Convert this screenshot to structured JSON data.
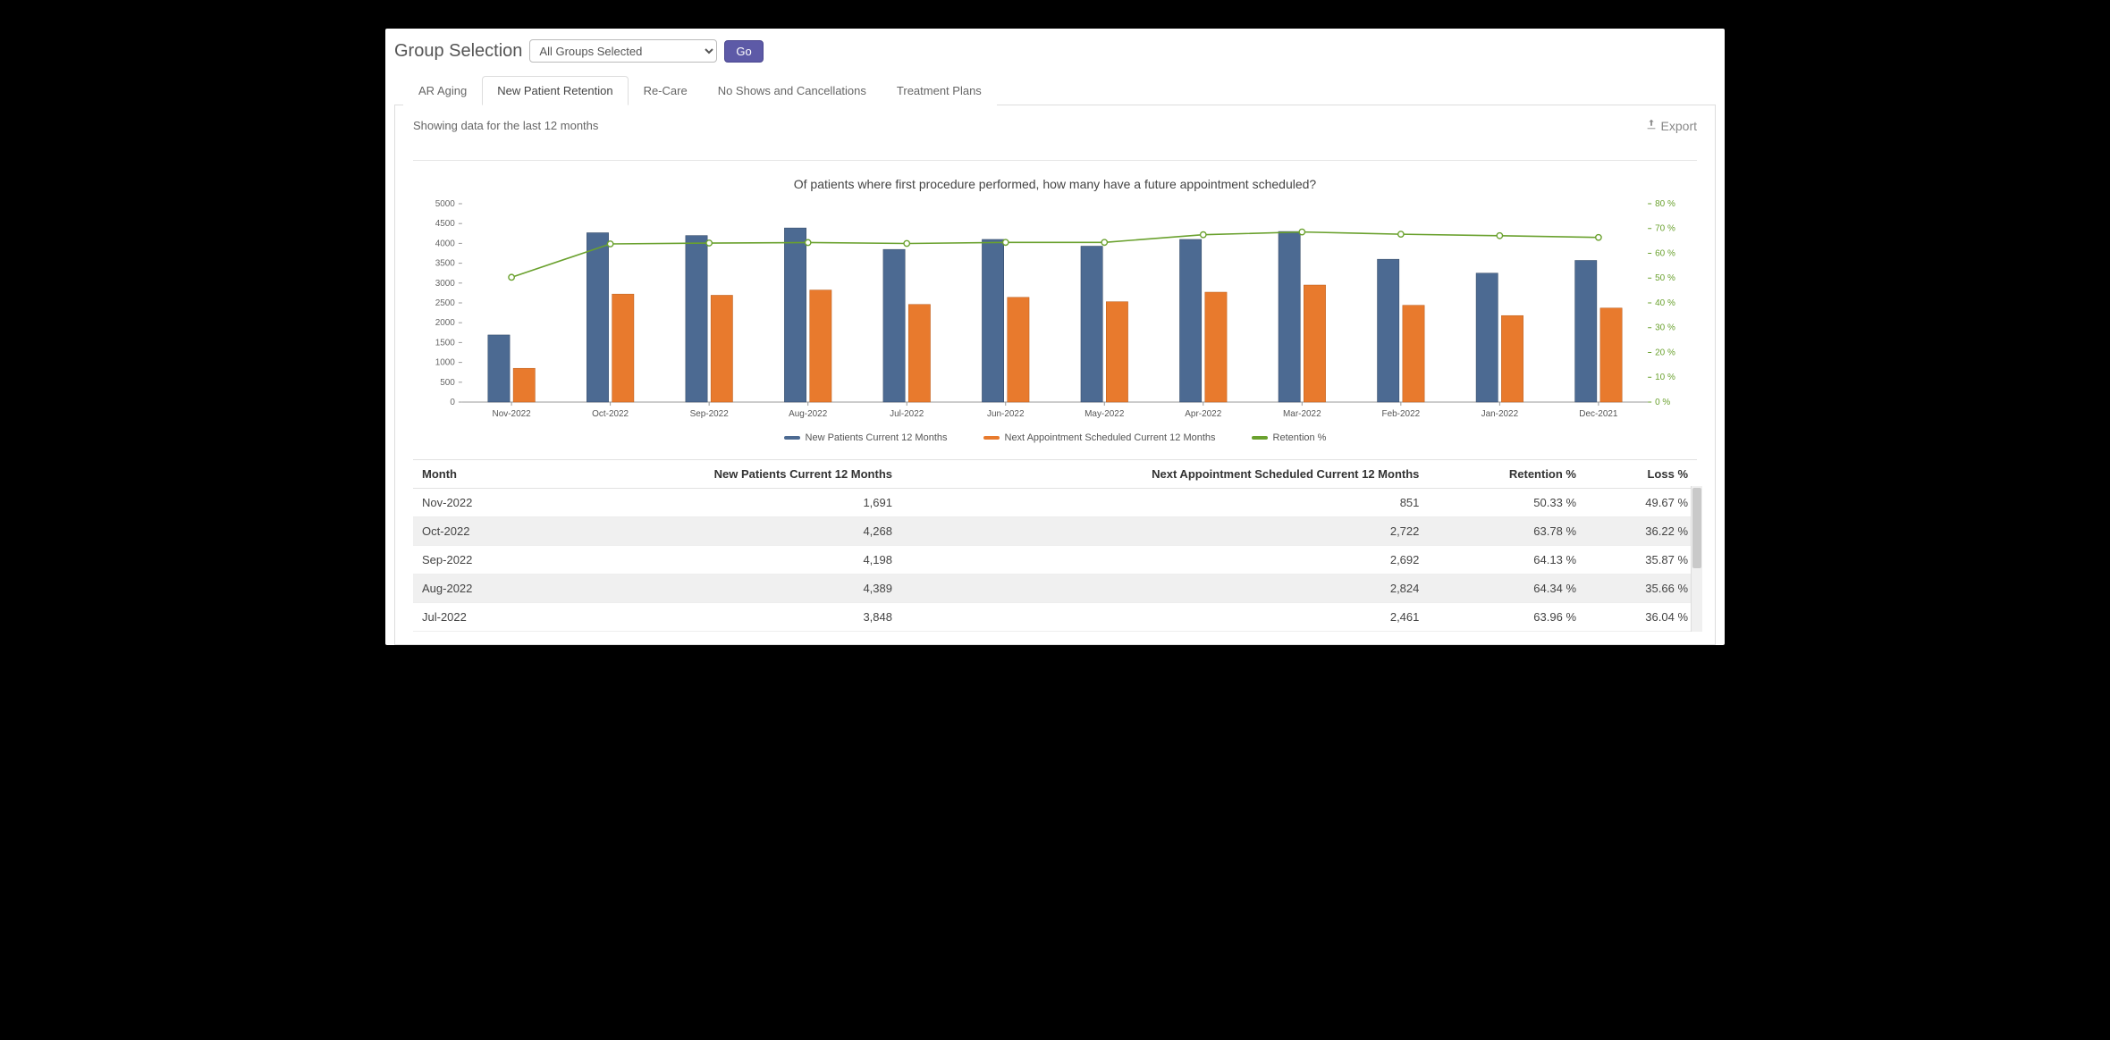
{
  "topbar": {
    "label": "Group Selection",
    "dropdown_value": "All Groups Selected",
    "go_label": "Go"
  },
  "tabs": [
    {
      "id": "ar",
      "label": "AR Aging"
    },
    {
      "id": "npr",
      "label": "New Patient Retention"
    },
    {
      "id": "rc",
      "label": "Re-Care"
    },
    {
      "id": "nsc",
      "label": "No Shows and Cancellations"
    },
    {
      "id": "tp",
      "label": "Treatment Plans"
    }
  ],
  "active_tab": "npr",
  "panel": {
    "subtitle": "Showing data for the last 12 months",
    "export_label": "Export"
  },
  "chart_data": {
    "type": "bar+line",
    "title": "Of patients where first procedure performed, how many have a future appointment scheduled?",
    "categories": [
      "Nov-2022",
      "Oct-2022",
      "Sep-2022",
      "Aug-2022",
      "Jul-2022",
      "Jun-2022",
      "May-2022",
      "Apr-2022",
      "Mar-2022",
      "Feb-2022",
      "Jan-2022",
      "Dec-2021"
    ],
    "ylim_left": [
      0,
      5000
    ],
    "yticks_left": [
      0,
      500,
      1000,
      1500,
      2000,
      2500,
      3000,
      3500,
      4000,
      4500,
      5000
    ],
    "ylim_right": [
      0,
      80
    ],
    "yticks_right": [
      0,
      10,
      20,
      30,
      40,
      50,
      60,
      70,
      80
    ],
    "series": [
      {
        "name": "New Patients Current 12 Months",
        "type": "bar",
        "color": "#4c6a92",
        "values": [
          1691,
          4268,
          4198,
          4389,
          3848,
          4100,
          3930,
          4100,
          4300,
          3600,
          3250,
          3570
        ]
      },
      {
        "name": "Next Appointment Scheduled Current 12 Months",
        "type": "bar",
        "color": "#e87a2d",
        "values": [
          851,
          2722,
          2692,
          2824,
          2461,
          2640,
          2530,
          2770,
          2950,
          2440,
          2180,
          2370
        ]
      },
      {
        "name": "Retention %",
        "type": "line",
        "color": "#6aa12e",
        "axis": "right",
        "values": [
          50.33,
          63.78,
          64.13,
          64.34,
          63.96,
          64.4,
          64.4,
          67.5,
          68.6,
          67.7,
          67.1,
          66.4
        ]
      }
    ],
    "legend_position": "bottom"
  },
  "table": {
    "headers": [
      "Month",
      "New Patients Current 12 Months",
      "Next Appointment Scheduled Current 12 Months",
      "Retention %",
      "Loss %"
    ],
    "rows": [
      {
        "month": "Nov-2022",
        "new": "1,691",
        "next": "851",
        "ret": "50.33 %",
        "loss": "49.67 %"
      },
      {
        "month": "Oct-2022",
        "new": "4,268",
        "next": "2,722",
        "ret": "63.78 %",
        "loss": "36.22 %"
      },
      {
        "month": "Sep-2022",
        "new": "4,198",
        "next": "2,692",
        "ret": "64.13 %",
        "loss": "35.87 %"
      },
      {
        "month": "Aug-2022",
        "new": "4,389",
        "next": "2,824",
        "ret": "64.34 %",
        "loss": "35.66 %"
      },
      {
        "month": "Jul-2022",
        "new": "3,848",
        "next": "2,461",
        "ret": "63.96 %",
        "loss": "36.04 %"
      }
    ]
  },
  "colors": {
    "bar1": "#4c6a92",
    "bar2": "#e87a2d",
    "line": "#6aa12e"
  }
}
